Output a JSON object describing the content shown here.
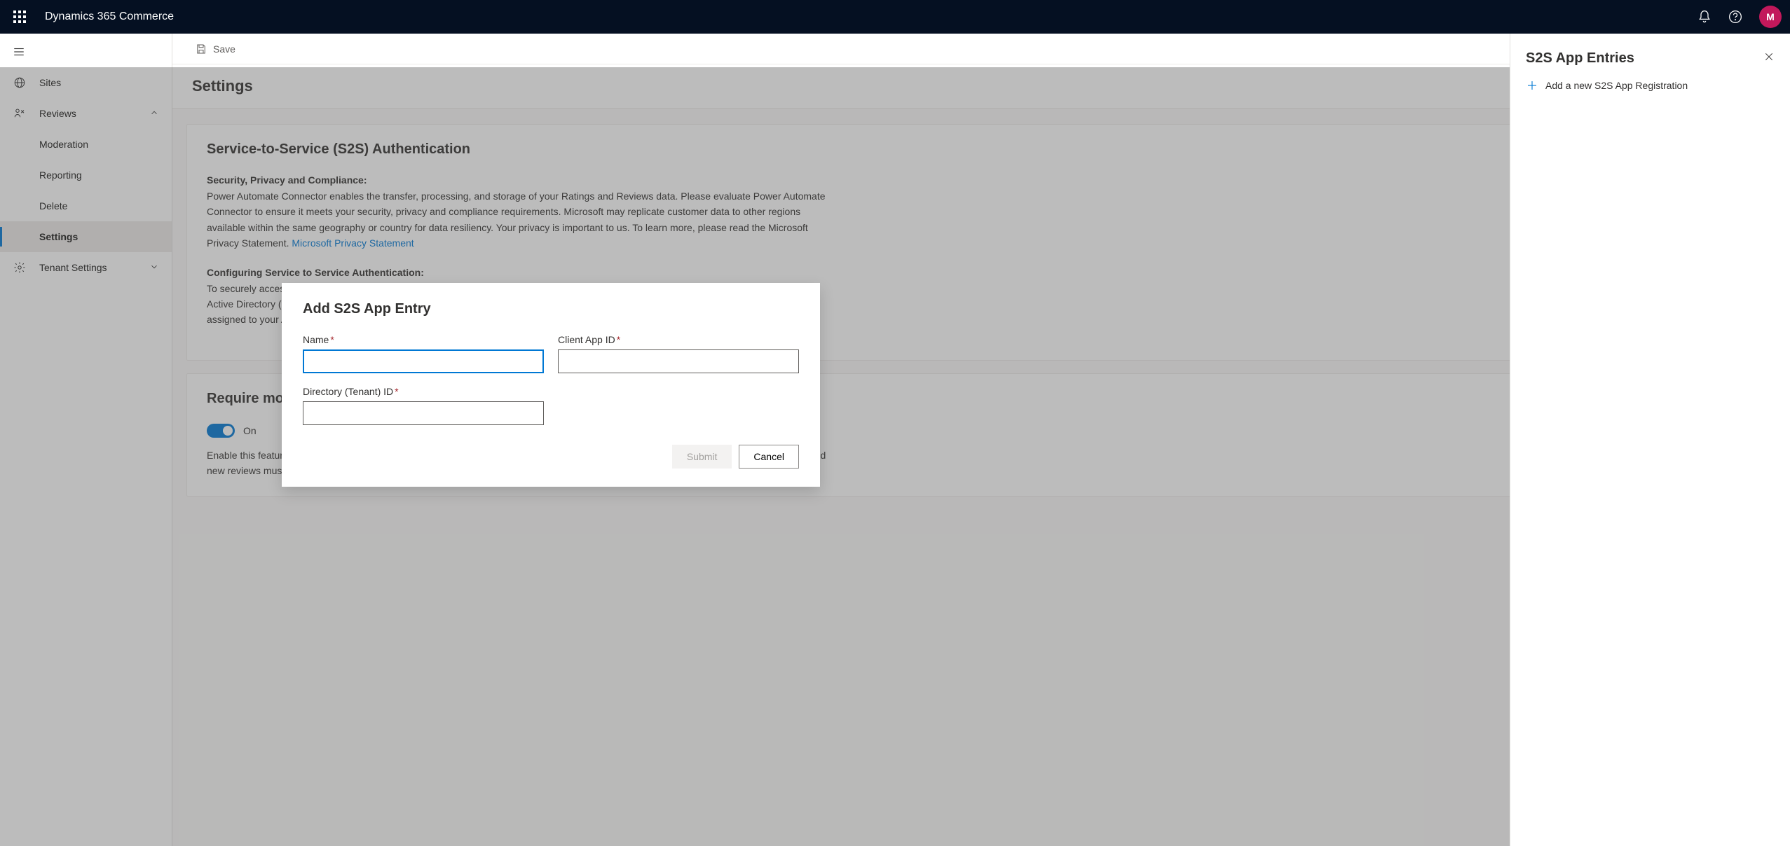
{
  "header": {
    "app_title": "Dynamics 365 Commerce",
    "avatar_initial": "M"
  },
  "sidebar": {
    "sites": "Sites",
    "reviews": "Reviews",
    "moderation": "Moderation",
    "reporting": "Reporting",
    "delete": "Delete",
    "settings": "Settings",
    "tenant_settings": "Tenant Settings"
  },
  "command": {
    "save": "Save"
  },
  "page": {
    "title": "Settings"
  },
  "s2s": {
    "title": "Service-to-Service (S2S) Authentication",
    "security_heading": "Security, Privacy and Compliance:",
    "security_body": "Power Automate Connector enables the transfer, processing, and storage of your Ratings and Reviews data. Please evaluate Power Automate Connector to ensure it meets your security, privacy and compliance requirements. Microsoft may replicate customer data to other regions available within the same geography or country for data resiliency. Your privacy is important to us. To learn more, please read the Microsoft Privacy Statement.",
    "link": "Microsoft Privacy Statement",
    "config_heading": "Configuring Service to Service Authentication:",
    "config_body": "To securely access Ratings and Reviews using service to service authentication first make sure you have registered an application in Azure Active Directory (see how). Then create a new S2S entry below and enter a descriptive name then fill in the Azure Tenant ID and Client ID assigned to your AAD application."
  },
  "moderator": {
    "title": "Require moderator for ratings and reviews",
    "toggle_label": "On",
    "desc": "Enable this feature to require a moderator to approve ratings and reviews before publishing. Enabling this feature will hide existing reviews and new reviews must be approved before publishing. Azure Cognitive Services will continue to filter profanity in titles and content."
  },
  "panel": {
    "title": "S2S App Entries",
    "add": "Add a new S2S App Registration"
  },
  "dialog": {
    "title": "Add S2S App Entry",
    "name_label": "Name",
    "client_label": "Client App ID",
    "tenant_label": "Directory (Tenant) ID",
    "submit": "Submit",
    "cancel": "Cancel"
  }
}
